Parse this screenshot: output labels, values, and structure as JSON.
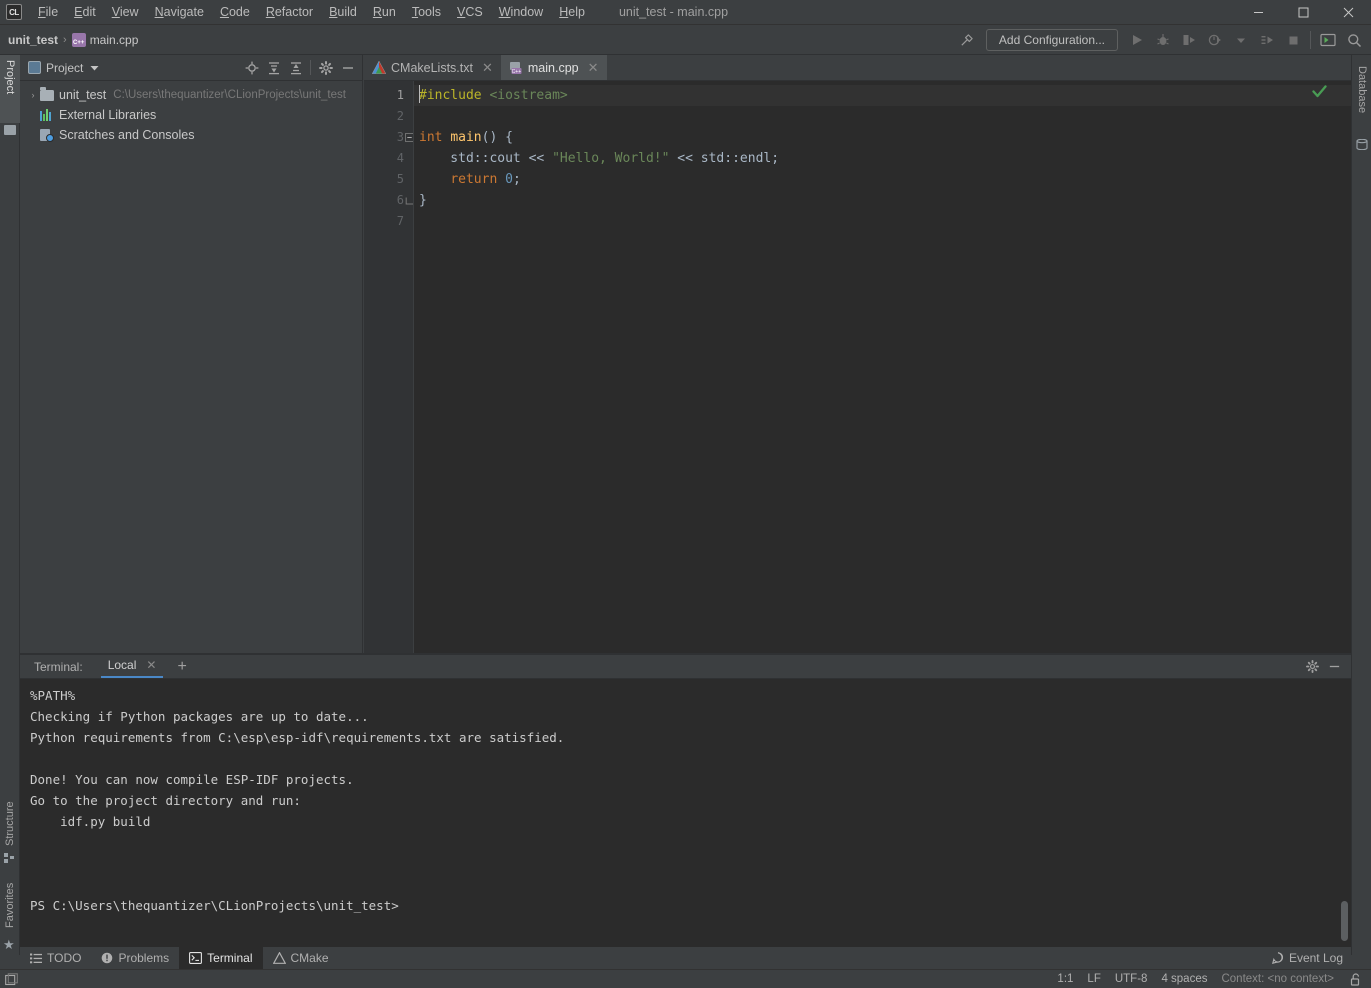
{
  "window": {
    "title": "unit_test - main.cpp",
    "app_icon_text": "CL",
    "minimize": "—",
    "maximize": "□",
    "close": "✕"
  },
  "menu": {
    "items": [
      {
        "label": "File",
        "first": "F",
        "rest": "ile"
      },
      {
        "label": "Edit",
        "first": "E",
        "rest": "dit"
      },
      {
        "label": "View",
        "first": "V",
        "rest": "iew"
      },
      {
        "label": "Navigate",
        "first": "N",
        "rest": "avigate"
      },
      {
        "label": "Code",
        "first": "C",
        "rest": "ode"
      },
      {
        "label": "Refactor",
        "first": "R",
        "rest": "efactor"
      },
      {
        "label": "Build",
        "first": "B",
        "rest": "uild"
      },
      {
        "label": "Run",
        "first": "R",
        "rest": "un"
      },
      {
        "label": "Tools",
        "first": "T",
        "rest": "ools"
      },
      {
        "label": "VCS",
        "first": "V",
        "rest": "CS"
      },
      {
        "label": "Window",
        "first": "W",
        "rest": "indow"
      },
      {
        "label": "Help",
        "first": "H",
        "rest": "elp"
      }
    ]
  },
  "navbar": {
    "breadcrumb_project": "unit_test",
    "breadcrumb_separator": "›",
    "breadcrumb_file": "main.cpp",
    "file_icon": "cpp-file-icon",
    "add_configuration": "Add Configuration...",
    "icons": [
      "hammer-build-icon",
      "run-icon",
      "debug-icon",
      "run-with-coverage-icon",
      "profile-icon",
      "dropdown-icon",
      "attach-debugger-icon",
      "stop-icon",
      "terminal-icon",
      "search-everywhere-icon"
    ]
  },
  "left_stripe": {
    "project_tab": "Project",
    "structure_tab": "Structure",
    "favorites_tab": "Favorites"
  },
  "right_stripe": {
    "database_tab": "Database"
  },
  "project_panel": {
    "title": "Project",
    "dropdown_icon": "chevron-down-icon",
    "actions": [
      "locate-in-tree-icon",
      "expand-all-icon",
      "collapse-all-icon",
      "settings-gear-icon",
      "hide-panel-icon"
    ],
    "tree": [
      {
        "label": "unit_test",
        "sublabel": "C:\\Users\\thequantizer\\CLionProjects\\unit_test",
        "icon": "folder-icon",
        "arrow": "›",
        "expanded": false
      },
      {
        "label": "External Libraries",
        "sublabel": "",
        "icon": "external-libraries-icon",
        "arrow": "",
        "expanded": false
      },
      {
        "label": "Scratches and Consoles",
        "sublabel": "",
        "icon": "scratches-icon",
        "arrow": "",
        "expanded": false
      }
    ]
  },
  "editor": {
    "tabs": [
      {
        "label": "CMakeLists.txt",
        "icon": "cmake-file-icon",
        "active": false,
        "close": "✕"
      },
      {
        "label": "main.cpp",
        "icon": "cpp-file-icon",
        "active": true,
        "close": "✕"
      }
    ],
    "inspection_status": "✔",
    "line_numbers": [
      "1",
      "2",
      "3",
      "4",
      "5",
      "6",
      "7"
    ],
    "lines": [
      {
        "n": 1,
        "tokens": [
          {
            "t": "#include ",
            "c": "k-macro"
          },
          {
            "t": "<iostream>",
            "c": "k-str-inc"
          }
        ]
      },
      {
        "n": 2,
        "tokens": []
      },
      {
        "n": 3,
        "tokens": [
          {
            "t": "int ",
            "c": "k-kw"
          },
          {
            "t": "main",
            "c": "k-fn"
          },
          {
            "t": "() {",
            "c": "k-plain"
          }
        ]
      },
      {
        "n": 4,
        "tokens": [
          {
            "t": "    std::cout ",
            "c": "k-plain"
          },
          {
            "t": "<< ",
            "c": "k-op"
          },
          {
            "t": "\"Hello, World!\"",
            "c": "k-str"
          },
          {
            "t": " << ",
            "c": "k-op"
          },
          {
            "t": "std::endl;",
            "c": "k-plain"
          }
        ]
      },
      {
        "n": 5,
        "tokens": [
          {
            "t": "    ",
            "c": "k-plain"
          },
          {
            "t": "return ",
            "c": "k-kw"
          },
          {
            "t": "0",
            "c": "k-num"
          },
          {
            "t": ";",
            "c": "k-plain"
          }
        ]
      },
      {
        "n": 6,
        "tokens": [
          {
            "t": "}",
            "c": "k-plain"
          }
        ]
      },
      {
        "n": 7,
        "tokens": []
      }
    ]
  },
  "terminal": {
    "label": "Terminal:",
    "tab_name": "Local",
    "tab_close": "✕",
    "add_tab": "+",
    "settings_icon": "gear-icon",
    "hide_icon": "minimize-icon",
    "output": [
      "%PATH%",
      "Checking if Python packages are up to date...",
      "Python requirements from C:\\esp\\esp-idf\\requirements.txt are satisfied.",
      "",
      "Done! You can now compile ESP-IDF projects.",
      "Go to the project directory and run:",
      "    idf.py build",
      "",
      "",
      "",
      "PS C:\\Users\\thequantizer\\CLionProjects\\unit_test>"
    ]
  },
  "bottom_tabs": {
    "items": [
      {
        "label": "TODO",
        "icon": "todo-icon",
        "active": false
      },
      {
        "label": "Problems",
        "icon": "problems-icon",
        "active": false
      },
      {
        "label": "Terminal",
        "icon": "terminal-icon",
        "active": true
      },
      {
        "label": "CMake",
        "icon": "cmake-icon",
        "active": false
      }
    ],
    "event_log": "Event Log",
    "event_log_icon": "event-log-icon"
  },
  "statusbar": {
    "layout_icon": "layout-icon",
    "caret_position": "1:1",
    "line_separator": "LF",
    "encoding": "UTF-8",
    "indent": "4 spaces",
    "context": "Context: <no context>",
    "lock_icon": "unlocked-icon"
  },
  "colors": {
    "chrome": "#3c3f41",
    "editor_bg": "#2b2b2b",
    "gutter_bg": "#313335",
    "accent_blue": "#4a88c7",
    "tab_active": "#4e5254",
    "success_green": "#499c54",
    "keyword_orange": "#cc7832",
    "string_green": "#6a8759",
    "function_yellow": "#ffc66d",
    "number_blue": "#6897bb",
    "macro_olive": "#bbb529",
    "text": "#a9b7c6"
  }
}
